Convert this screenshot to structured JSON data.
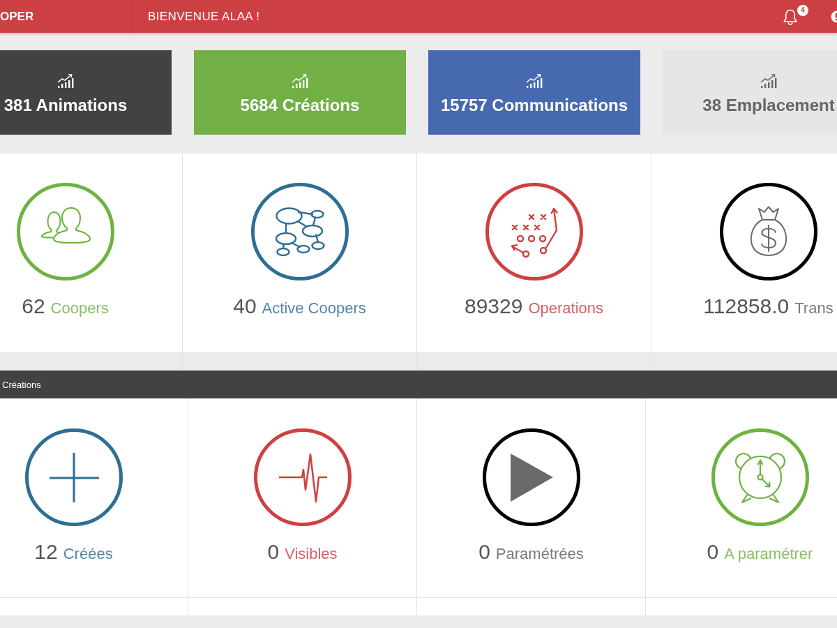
{
  "header": {
    "brand": "OPER",
    "welcome": "BIENVENUE ALAA !",
    "notification_count": "4"
  },
  "tiles": [
    {
      "text": "381 Animations",
      "color": "#424242"
    },
    {
      "text": "5684 Créations",
      "color": "#72b046"
    },
    {
      "text": "15757 Communications",
      "color": "#4769b0"
    },
    {
      "text": "38 Emplacement",
      "color": "#e6e6e6"
    }
  ],
  "stats": [
    {
      "value": "62",
      "label": "Coopers",
      "color": "#6db33f"
    },
    {
      "value": "40",
      "label": "Active Coopers",
      "color": "#2e6e93"
    },
    {
      "value": "89329",
      "label": "Operations",
      "color": "#d04040"
    },
    {
      "value": "112858.0",
      "label": "Trans",
      "color": "#000000"
    }
  ],
  "creations": {
    "title": "Créations",
    "items": [
      {
        "value": "12",
        "label": "Créées",
        "color": "#2e6e93"
      },
      {
        "value": "0",
        "label": "Visibles",
        "color": "#d04040"
      },
      {
        "value": "0",
        "label": "Paramétrées",
        "color": "#000000"
      },
      {
        "value": "0",
        "label": "A paramétrer",
        "color": "#6db33f"
      }
    ]
  }
}
